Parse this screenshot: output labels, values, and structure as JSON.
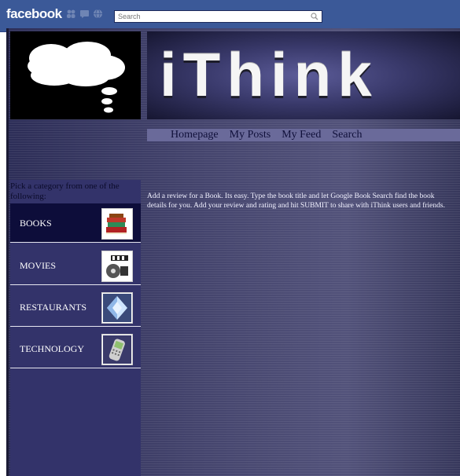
{
  "fb": {
    "logo": "facebook",
    "search_placeholder": "Search"
  },
  "app": {
    "title": "iThink",
    "nav": [
      "Homepage",
      "My Posts",
      "My Feed",
      "Search"
    ],
    "sidebar_prompt": "Pick a category from one of the following:",
    "categories": [
      "BOOKS",
      "MOVIES",
      "RESTAURANTS",
      "TECHNOLOGY"
    ],
    "intro": "Add a review for a Book. Its easy. Type the book title and let Google Book Search find the book details for you. Add your review and rating and hit SUBMIT to share with iThink users and friends."
  },
  "colors": {
    "fb_blue": "#3b5998",
    "app_bg": "#3f3f6a",
    "selected_category": "#0d0d3a"
  },
  "icons": [
    "friends-icon",
    "messages-icon",
    "notifications-icon",
    "search-icon",
    "thought-cloud-icon",
    "books-icon",
    "film-icon",
    "diamond-icon",
    "phone-icon"
  ]
}
